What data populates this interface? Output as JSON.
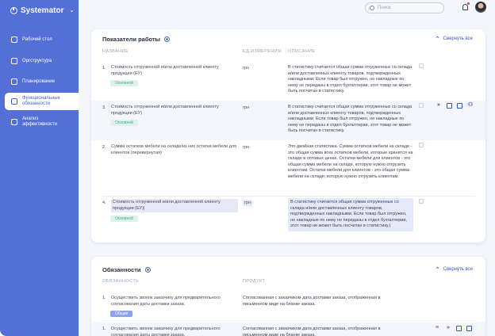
{
  "app": {
    "brand": "Systemator"
  },
  "sidebar": {
    "items": [
      {
        "label": "Рабочий стол",
        "icon": "grid-icon"
      },
      {
        "label": "Оргструктура",
        "icon": "org-chart-icon"
      },
      {
        "label": "Планирование",
        "icon": "calendar-icon"
      },
      {
        "label": "Функциональные обязанности",
        "icon": "hierarchy-icon",
        "active": true
      },
      {
        "label": "Анализ эффективности",
        "icon": "bar-chart-icon"
      }
    ]
  },
  "topbar": {
    "search_placeholder": "Поиск"
  },
  "colors": {
    "accent": "#4a64c8",
    "sidebar": "#5470d6",
    "tag_green": "#4ba887"
  },
  "metrics": {
    "title": "Показатели работы",
    "collapse_label": "Свернуть все",
    "col_name": "НАЗВАНИЕ",
    "col_unit": "ЕД.ИЗМЕРЕНИЯ",
    "col_desc": "ОПИСАНИЕ",
    "rows": [
      {
        "num": "1.",
        "name": "Стоимость отгруженной и/или доставленной клиенту продукции (ЕУ)",
        "tag": "Основной",
        "unit": "грн",
        "desc": "В статистику считается общая сумма отгруженных со склада и/или доставленных клиенту товаров, подтвержденных накладными. Если товар был отгружен, но накладные по нему не переданы в отдел бухгалтерии, этот товар не может быть посчитан в статистику."
      },
      {
        "num": "3.",
        "name": "Стоимость отгруженной и/или доставленной клиенту продукции (ЕУ)",
        "tag": "Основной",
        "unit": "грн",
        "desc": "В статистику считается общая сумма отгруженных со склада и/или доставленных клиенту товаров, подтвержденных накладными. Если товар был отгружен, но накладные по нему не переданы в отдел бухгалтерии, этот товар не может быть посчитан в статистику."
      },
      {
        "num": "2.",
        "name": "Сумма остатков мебели на складе/из них остатки мебели для клиентов (перевернутая)",
        "tag": "",
        "unit": "грн",
        "desc": "Это двойная статистика. Сумма остатков мебели на складе - это общая сумма всех остатков мебели, которые хранятся на складе в оптовых ценах. Остатки мебели для клиентов - это общая сумма мебели на складе, которую нужно отгрузить клиентам. Остатки мебели для клиентов - это общая сумма мебели на складе, которую нужно отгрузить клиентам."
      },
      {
        "num": "4.",
        "name": "Стоимость отгруженной и/или доставленной клиенту продукции (ЕУ)|",
        "tag": "Основной",
        "unit": "грн",
        "desc": "В статистику считается общая сумма отгруженных со склада и/или доставленных клиенту товаров, подтвержденных накладными. Если товар был отгружен, но накладные по нему не переданы в отдел бухгалтерии, этот товар не может быть посчитан в статистику.|"
      }
    ]
  },
  "duties": {
    "title": "Обязанности",
    "collapse_label": "Свернуть все",
    "col_duty": "ОБЯЗАННОСТЬ",
    "col_product": "ПРОДУКТ",
    "rows": [
      {
        "num": "1.",
        "name": "Осуществить звонок заказчику для предварительного согласования даты доставки заказа.",
        "tag": "Общая",
        "product": "Согласованная с заказчиком дата доставки заказа, отображенная в письменном виде на бланке заказа."
      },
      {
        "num": "1.",
        "name": "Осуществить звонок заказчику для предварительного согласования даты доставки заказа.",
        "tag": "",
        "product": "Согласованная с заказчиком дата доставки заказа, отображенная в письменном виде на бланке заказа."
      }
    ]
  }
}
